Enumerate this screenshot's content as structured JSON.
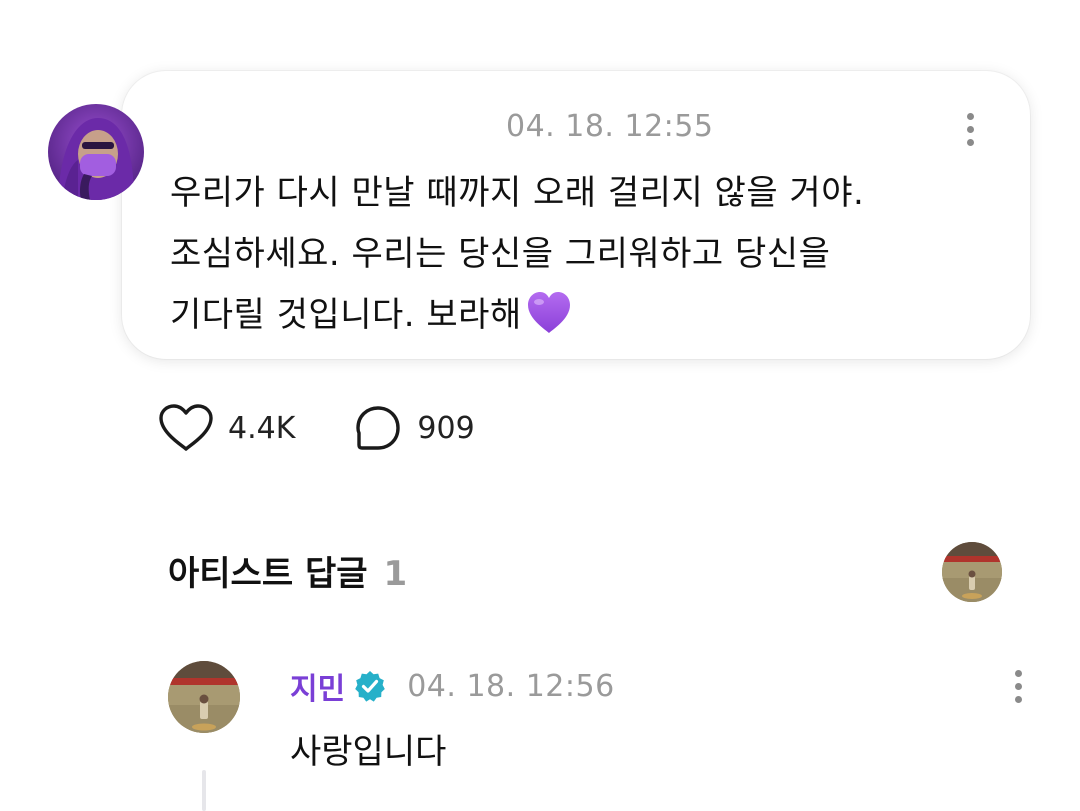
{
  "post": {
    "author_avatar": "purple-hooded-masked-person-avatar",
    "timestamp": "04. 18. 12:55",
    "text": "우리가 다시 만날 때까지 오래 걸리지 않을 거야.\n조심하세요. 우리는 당신을 그리워하고 당신을\n기다릴 것입니다. 보라해",
    "text_emoji": "purple-heart-icon",
    "menu_icon": "kebab-menu-icon"
  },
  "actions": {
    "likes": {
      "icon": "heart-outline-icon",
      "count": "4.4K"
    },
    "comments": {
      "icon": "speech-bubble-icon",
      "count": "909"
    }
  },
  "artist_replies": {
    "title": "아티스트 답글",
    "count": "1",
    "header_avatar": "artist-avatar-stadium",
    "replies": [
      {
        "name": "지민",
        "verified_icon": "verified-badge-icon",
        "timestamp": "04. 18. 12:56",
        "text": "사랑입니다",
        "avatar": "artist-avatar-stadium"
      }
    ]
  },
  "colors": {
    "artist_name": "#7a3fd6",
    "verified_badge": "#26b0c9",
    "muted_text": "#9a9a9a",
    "heart_emoji": "#9b4fe0"
  }
}
